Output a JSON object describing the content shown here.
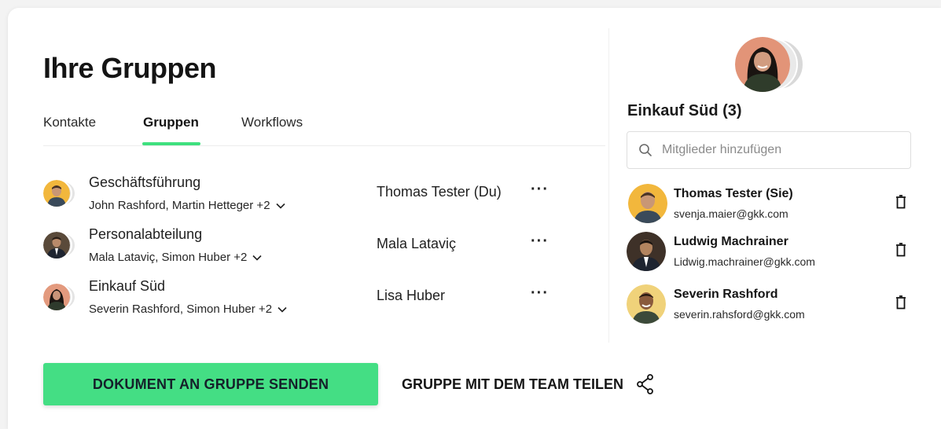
{
  "page": {
    "title": "Ihre Gruppen",
    "tabs": [
      {
        "label": "Kontakte",
        "active": false
      },
      {
        "label": "Gruppen",
        "active": true
      },
      {
        "label": "Workflows",
        "active": false
      }
    ],
    "accent_color": "#44de84"
  },
  "groups": [
    {
      "name": "Geschäftsführung",
      "members": "John Rashford, Martin Hetteger +2",
      "owner": "Thomas Tester (Du)",
      "more_icon": "ellipsis-icon"
    },
    {
      "name": "Personalabteilung",
      "members": "Mala Lataviç, Simon Huber +2",
      "owner": "Mala Lataviç",
      "more_icon": "ellipsis-icon"
    },
    {
      "name": "Einkauf Süd",
      "members": "Severin Rashford, Simon Huber +2",
      "owner": "Lisa Huber",
      "more_icon": "ellipsis-icon"
    }
  ],
  "side_panel": {
    "title": "Einkauf Süd (3)",
    "search_placeholder": "Mitglieder hinzufügen",
    "members": [
      {
        "name": "Thomas Tester (Sie)",
        "email": "svenja.maier@gkk.com"
      },
      {
        "name": "Ludwig Machrainer",
        "email": "Lidwig.machrainer@gkk.com"
      },
      {
        "name": "Severin Rashford",
        "email": "severin.rahsford@gkk.com"
      }
    ]
  },
  "actions": {
    "send_label": "DOKUMENT AN GRUPPE SENDEN",
    "share_label": "GRUPPE MIT DEM TEAM TEILEN"
  }
}
